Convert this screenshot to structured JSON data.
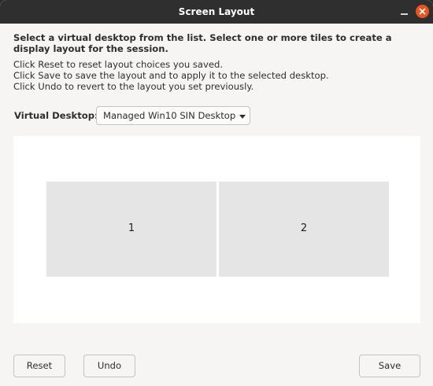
{
  "window": {
    "title": "Screen Layout",
    "accent_color": "#e95420"
  },
  "instructions": {
    "heading": "Select a virtual desktop from the list. Select one or more tiles to create a display layout for the session.",
    "lines": [
      "Click Reset to reset layout choices you saved.",
      "Click Save to save the layout and to apply it to the selected desktop.",
      "Click Undo to revert to the layout you set previously."
    ]
  },
  "virtual_desktop": {
    "label": "Virtual Desktop:",
    "selected": "Managed Win10 SIN Desktop"
  },
  "layout": {
    "tiles": [
      {
        "label": "1"
      },
      {
        "label": "2"
      }
    ]
  },
  "buttons": {
    "reset": "Reset",
    "undo": "Undo",
    "save": "Save"
  },
  "icons": {
    "minimize": "minimize-icon",
    "close": "close-icon",
    "dropdown": "chevron-down-icon"
  }
}
